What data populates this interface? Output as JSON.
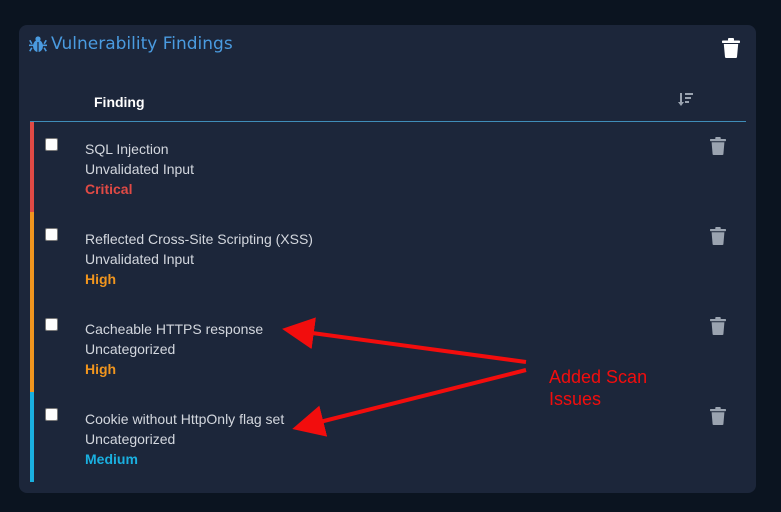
{
  "panel": {
    "title": "Vulnerability Findings",
    "title_icon": "bug-icon",
    "delete_icon": "trash-icon"
  },
  "table": {
    "column_header": "Finding",
    "sort_icon": "sort-icon"
  },
  "findings": [
    {
      "name": "SQL Injection",
      "category": "Unvalidated Input",
      "severity": "Critical",
      "color": "#e04a45"
    },
    {
      "name": "Reflected Cross-Site Scripting (XSS)",
      "category": "Unvalidated Input",
      "severity": "High",
      "color": "#f0951e"
    },
    {
      "name": "Cacheable HTTPS response",
      "category": "Uncategorized",
      "severity": "High",
      "color": "#f0951e"
    },
    {
      "name": "Cookie without HttpOnly flag set",
      "category": "Uncategorized",
      "severity": "Medium",
      "color": "#1ab0e0"
    }
  ],
  "annotation": {
    "line1": "Added Scan",
    "line2": "Issues",
    "color": "#f20d0d"
  },
  "colors": {
    "background": "#0b1420",
    "panel": "#1c263a",
    "accent": "#4a9be0",
    "text": "#d3d7de",
    "header_rule": "#3f8db8"
  }
}
